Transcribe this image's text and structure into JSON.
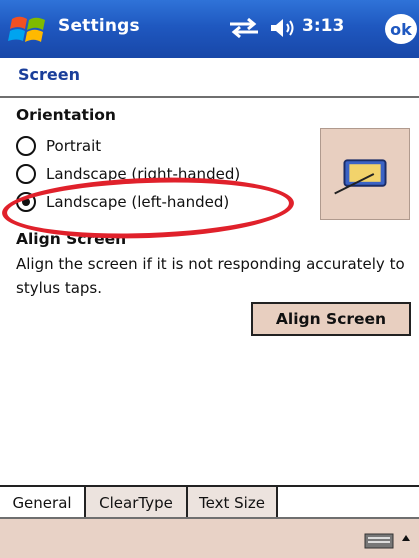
{
  "titlebar": {
    "title": "Settings",
    "time": "3:13",
    "ok_label": "ok",
    "start_icon": "windows-flag-icon",
    "connectivity_icon": "sync-arrows-icon",
    "volume_icon": "speaker-icon"
  },
  "header": {
    "title": "Screen"
  },
  "orientation": {
    "heading": "Orientation",
    "options": [
      {
        "label": "Portrait",
        "selected": false
      },
      {
        "label": "Landscape (right-handed)",
        "selected": false
      },
      {
        "label": "Landscape (left-handed)",
        "selected": true
      }
    ],
    "preview_icon": "landscape-screen-icon"
  },
  "align": {
    "heading": "Align Screen",
    "description": "Align the screen if it is not responding accurately to stylus taps.",
    "button_label": "Align Screen"
  },
  "tabs": [
    {
      "label": "General",
      "active": true
    },
    {
      "label": "ClearType",
      "active": false
    },
    {
      "label": "Text Size",
      "active": false
    }
  ],
  "bottombar": {
    "keyboard_icon": "keyboard-icon",
    "menu_arrow_icon": "up-arrow-icon"
  },
  "colors": {
    "titlebar": "#1f58c0",
    "header_text": "#1a3e9a",
    "button_bg": "#e8cfc0",
    "annotation": "#e0212b"
  }
}
